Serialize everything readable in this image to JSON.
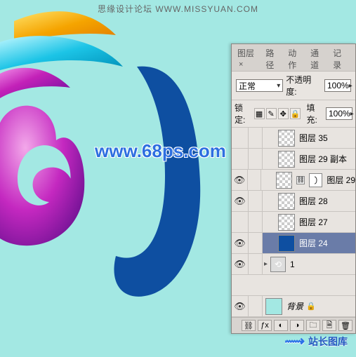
{
  "header": {
    "text": "思缘设计论坛  WWW.MISSYUAN.COM"
  },
  "watermark": {
    "text": "www.68ps.com"
  },
  "panel": {
    "tabs": {
      "t0": "图层",
      "close": "×",
      "t1": "路径",
      "t2": "动作",
      "t3": "通道",
      "t4": "记录"
    },
    "blend": {
      "value": "正常"
    },
    "opacity": {
      "label": "不透明度:",
      "value": "100%"
    },
    "lock": {
      "label": "锁定:"
    },
    "fill": {
      "label": "填充:",
      "value": "100%"
    },
    "layers": {
      "l0": "图层 35",
      "l1": "图层 29 副本",
      "l2": "图层 29",
      "l3": "图层 28",
      "l4": "图层 27",
      "l5": "图层 24",
      "l6": "1",
      "bg": "背景"
    }
  },
  "footer_logo": {
    "text": "站长图库"
  }
}
